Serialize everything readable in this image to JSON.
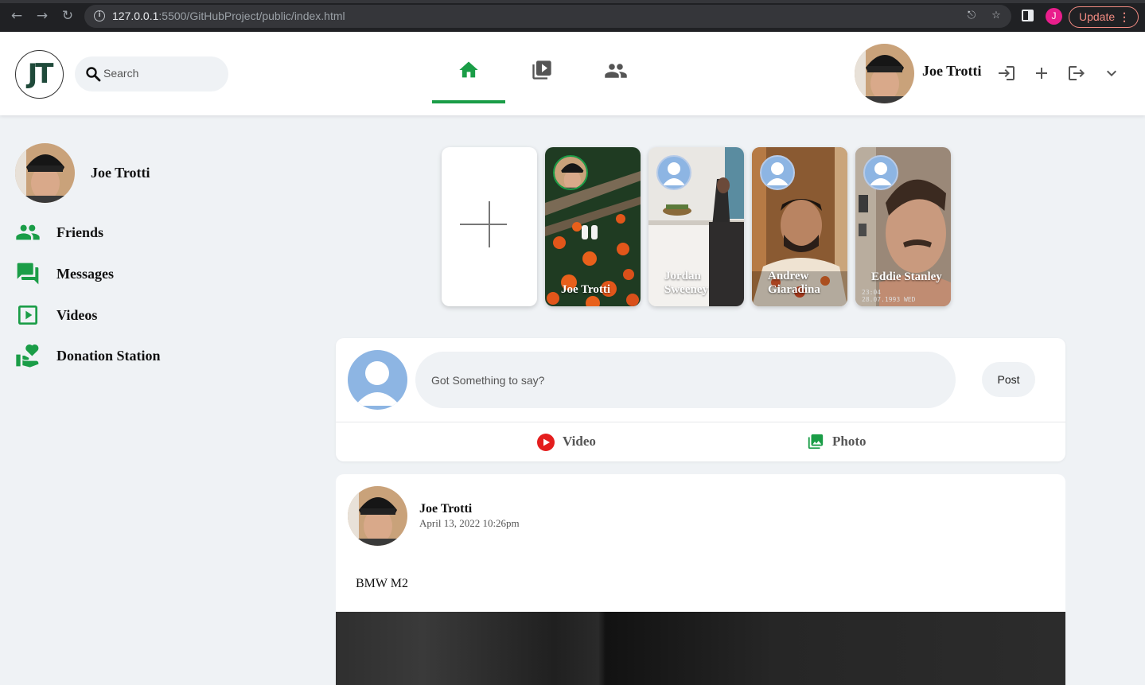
{
  "browser": {
    "url_host": "127.0.0.1",
    "url_rest": ":5500/GitHubProject/public/index.html",
    "profile_initial": "J",
    "update_label": "Update"
  },
  "header": {
    "logo_text": "JT",
    "search_placeholder": "Search",
    "user_name": "Joe Trotti",
    "accent_color": "#1a9d47"
  },
  "sidebar": {
    "user_name": "Joe Trotti",
    "items": [
      {
        "label": "Friends",
        "icon": "friends-icon"
      },
      {
        "label": "Messages",
        "icon": "messages-icon"
      },
      {
        "label": "Videos",
        "icon": "videos-icon"
      },
      {
        "label": "Donation Station",
        "icon": "donation-icon"
      }
    ]
  },
  "stories": [
    {
      "name": "Joe Trotti"
    },
    {
      "name": "Jordan Sweeney"
    },
    {
      "name": "Andrew Giaradina"
    },
    {
      "name": "Eddie Stanley",
      "stamp": "23:04\n28.07.1993 WED"
    }
  ],
  "composer": {
    "placeholder": "Got Something to say?",
    "post_label": "Post",
    "video_label": "Video",
    "photo_label": "Photo"
  },
  "feed": [
    {
      "author": "Joe Trotti",
      "date": "April 13, 2022 10:26pm",
      "text": "BMW M2"
    }
  ]
}
